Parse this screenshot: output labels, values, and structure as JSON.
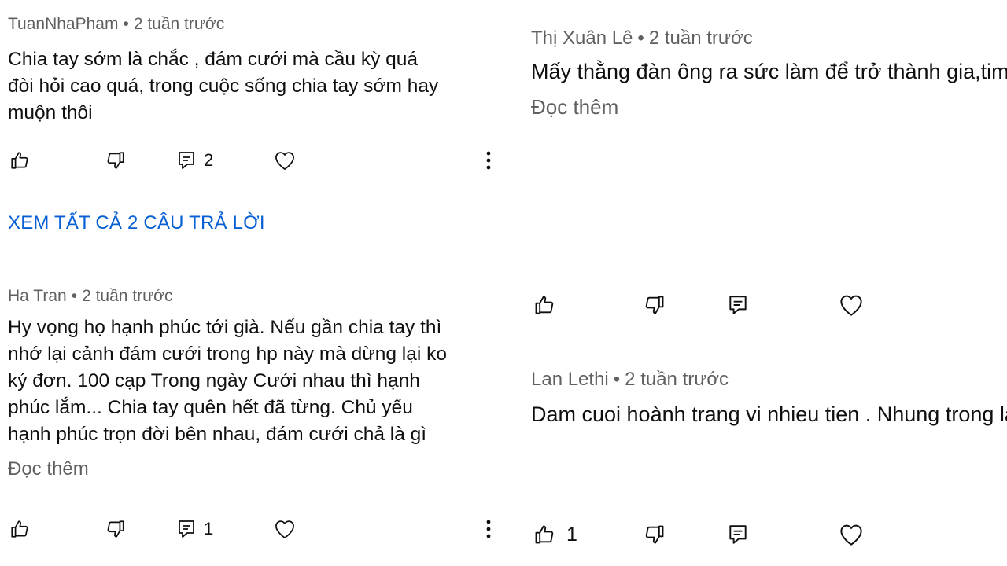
{
  "left": {
    "comment1": {
      "author": "TuanNhaPham",
      "time": "2 tuần trước",
      "text": "Chia tay sớm là chắc , đám cưới mà cầu kỳ quá\nđòi hỏi cao quá, trong cuộc sống chia tay sớm hay\nmuộn thôi",
      "reply_count": "2"
    },
    "view_replies": "XEM TẤT CẢ 2 CÂU TRẢ LỜI",
    "comment2": {
      "author": "Ha Tran",
      "time": "2 tuần trước",
      "text": "Hy vọng họ hạnh phúc tới già. Nếu gần chia tay thì\nnhớ lại cảnh đám cưới trong hp này mà dừng lại ko\nký đơn. 100 cạp Trong ngày Cưới nhau thì hạnh\nphúc lắm... Chia tay quên hết đã từng. Chủ yếu\nhạnh phúc trọn đời bên nhau, đám cưới chả là gì",
      "read_more": "Đọc thêm",
      "reply_count": "1"
    }
  },
  "right": {
    "comment1": {
      "author": "Thị Xuân Lê",
      "time": "2 tuần trước",
      "text": "Mấy thằng đàn ông ra sức làm để trở thành\ngia,tim cách bỏ vợ và vơ mấy con cs,dv nổi\nvà về làm đầy tớ cho nó suốt đời,nếu không\nhốt hết tiền nó bỏ nữa,vậy nên ai có chồng\nthì trước hết lo thủ tiền và nhà để mà chuẩn",
      "read_more": "Đọc thêm"
    },
    "comment2": {
      "author": "Lan Lethi",
      "time": "2 tuần trước",
      "text": "Dam cuoi hoành trang vi nhieu tien . Nhung\ntrong la cuoc doi moi người co may lan nhu\nKhg biết duoc bao lau thi den tạp hai ?",
      "like_count": "1"
    }
  },
  "separator": "•",
  "icons": {
    "like": "thumbs-up-icon",
    "dislike": "thumbs-down-icon",
    "reply": "reply-comment-icon",
    "heart": "heart-icon",
    "more": "more-vert-icon"
  },
  "colors": {
    "link_blue": "#065fd4",
    "meta_gray": "#606060",
    "text": "#0f0f0f"
  }
}
